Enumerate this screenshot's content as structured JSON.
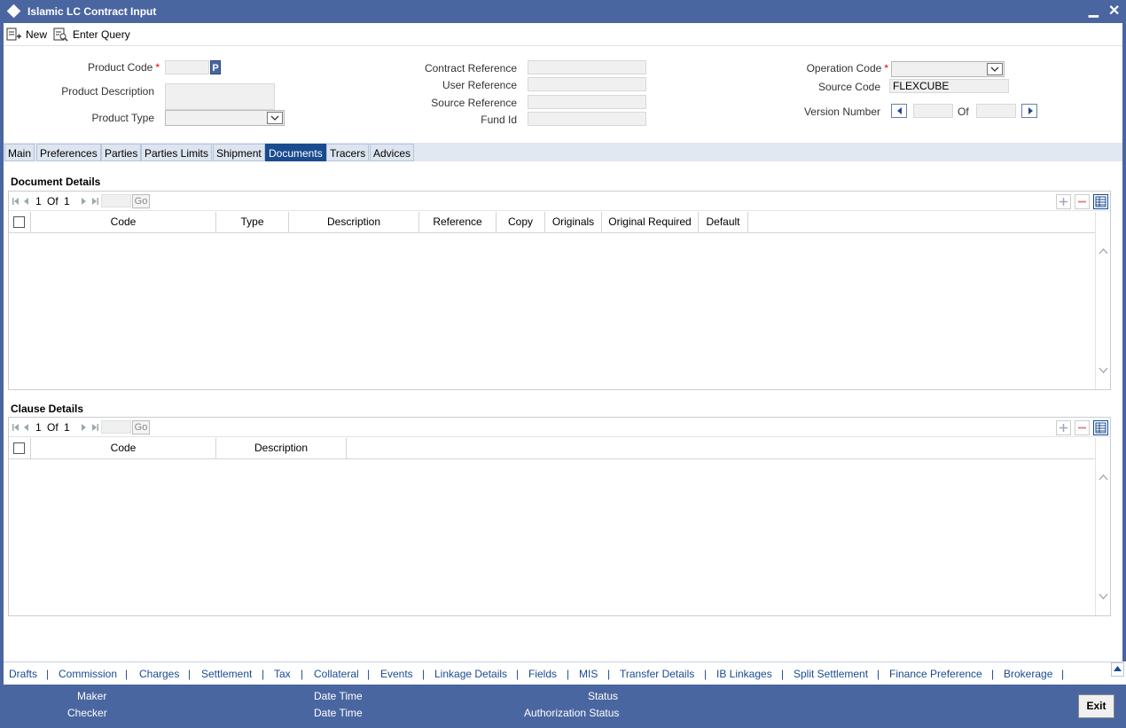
{
  "window": {
    "title": "Islamic LC Contract Input",
    "minimize_glyph": "▁",
    "close_glyph": "✕"
  },
  "toolbar": {
    "new_label": "New",
    "enter_query_label": "Enter Query"
  },
  "header": {
    "product_code_label": "Product Code",
    "product_code_value": "",
    "product_code_lookup": "P",
    "product_description_label": "Product Description",
    "product_description_value": "",
    "product_type_label": "Product Type",
    "product_type_value": "",
    "contract_reference_label": "Contract Reference",
    "contract_reference_value": "",
    "user_reference_label": "User Reference",
    "user_reference_value": "",
    "source_reference_label": "Source Reference",
    "source_reference_value": "",
    "fund_id_label": "Fund Id",
    "fund_id_value": "",
    "operation_code_label": "Operation Code",
    "operation_code_value": "",
    "source_code_label": "Source Code",
    "source_code_value": "FLEXCUBE",
    "version_number_label": "Version Number",
    "version_current": "",
    "version_of_label": "Of",
    "version_total": "",
    "required_marker": "*"
  },
  "tabs": [
    {
      "label": "Main",
      "active": false
    },
    {
      "label": "Preferences",
      "active": false
    },
    {
      "label": "Parties",
      "active": false
    },
    {
      "label": "Parties Limits",
      "active": false
    },
    {
      "label": "Shipment",
      "active": false
    },
    {
      "label": "Documents",
      "active": true
    },
    {
      "label": "Tracers",
      "active": false
    },
    {
      "label": "Advices",
      "active": false
    }
  ],
  "document_details": {
    "title": "Document Details",
    "page_current": "1",
    "page_of": "Of",
    "page_total": "1",
    "go_label": "Go",
    "columns": [
      "Code",
      "Type",
      "Description",
      "Reference",
      "Copy",
      "Originals",
      "Original Required",
      "Default"
    ],
    "rows": []
  },
  "clause_details": {
    "title": "Clause Details",
    "page_current": "1",
    "page_of": "Of",
    "page_total": "1",
    "go_label": "Go",
    "columns": [
      "Code",
      "Description"
    ],
    "rows": []
  },
  "bottom_links": [
    "Drafts",
    "Commission",
    "Charges",
    "Settlement",
    "Tax",
    "Collateral",
    "Events",
    "Linkage Details",
    "Fields",
    "MIS",
    "Transfer Details",
    "IB Linkages",
    "Split Settlement",
    "Finance Preference",
    "Brokerage"
  ],
  "link_separator": "|",
  "footer": {
    "maker_label": "Maker",
    "checker_label": "Checker",
    "date_time_label_1": "Date Time",
    "date_time_label_2": "Date Time",
    "status_label": "Status",
    "authorization_status_label": "Authorization Status",
    "exit_label": "Exit"
  },
  "colors": {
    "title_bar": "#4a66a0",
    "active_tab": "#1a4b8f",
    "link": "#1a4b8f",
    "required": "#dd0000"
  }
}
